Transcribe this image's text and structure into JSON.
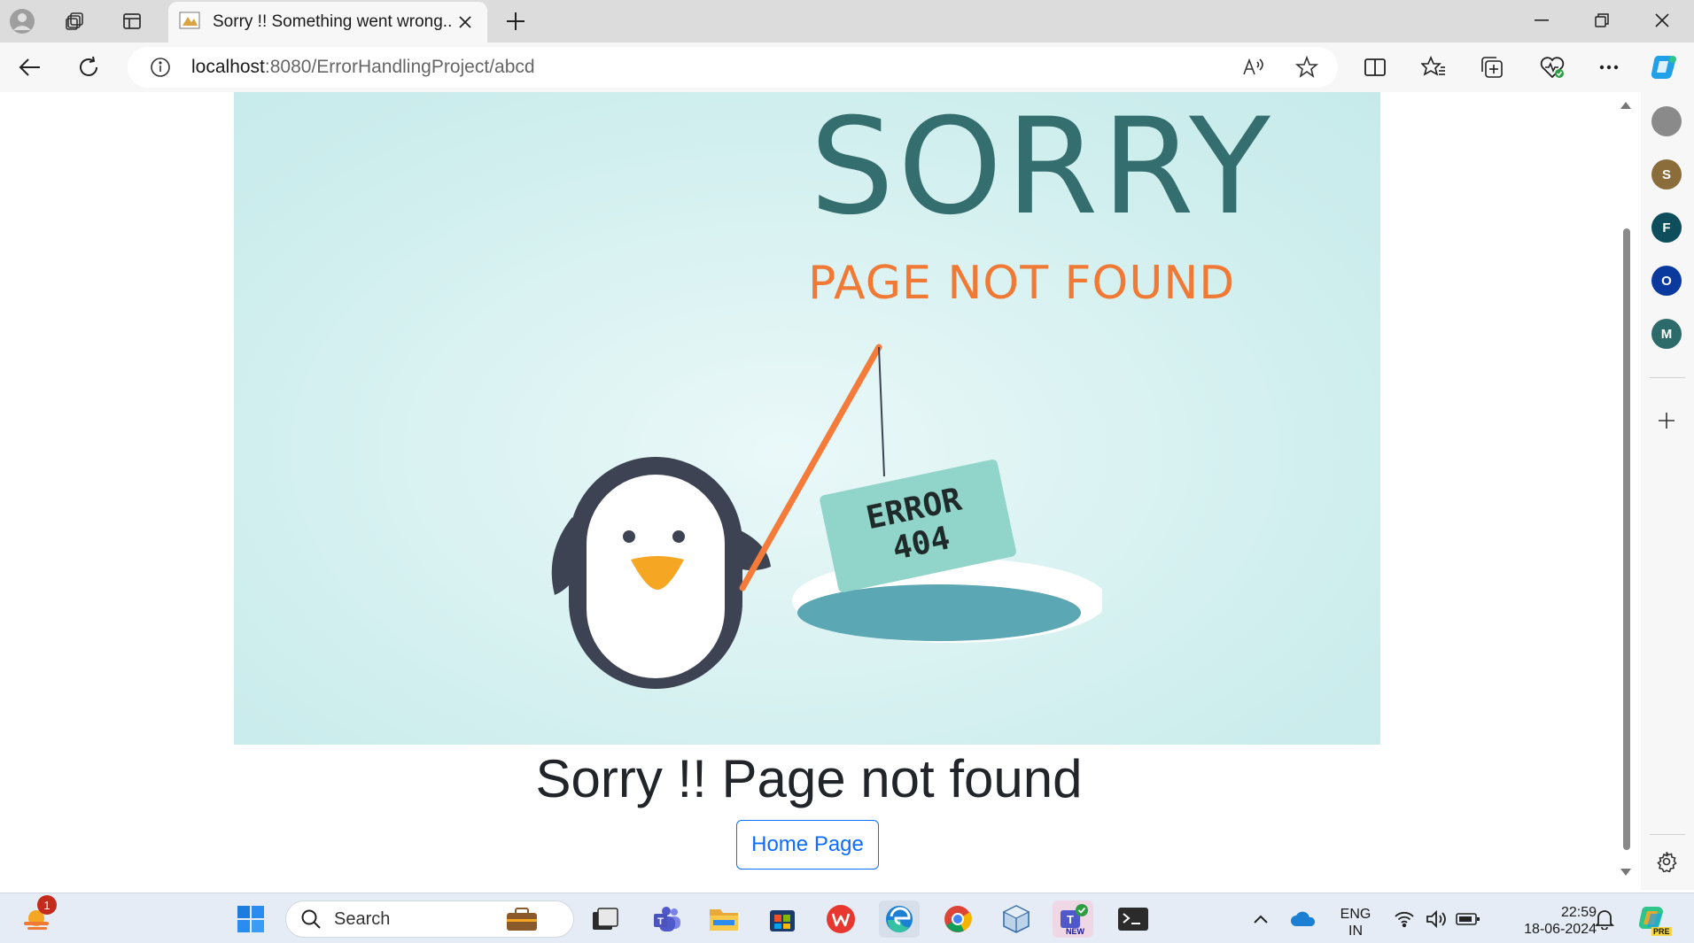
{
  "browser": {
    "tab_title": "Sorry !! Something went wrong...",
    "url_host": "localhost",
    "url_path": ":8080/ErrorHandlingProject/abcd",
    "sidebar_avatars": [
      {
        "letter": "S",
        "color": "#8a6d3b"
      },
      {
        "letter": "F",
        "color": "#0d4d5c"
      },
      {
        "letter": "O",
        "color": "#0a3a9e"
      },
      {
        "letter": "M",
        "color": "#2d6a6a"
      }
    ]
  },
  "page": {
    "hero_sorry": "SORRY",
    "hero_subtitle": "PAGE NOT FOUND",
    "sign_line1": "ERROR",
    "sign_line2": "404",
    "heading": "Sorry !! Page not found",
    "home_button": "Home Page"
  },
  "taskbar": {
    "search_placeholder": "Search",
    "notification_count": "1",
    "language_line1": "ENG",
    "language_line2": "IN",
    "time": "22:59",
    "date": "18-06-2024",
    "teams_badge": "NEW",
    "copilot_badge": "PRE"
  },
  "colors": {
    "accent": "#0d6efd",
    "hero_bg": "#cfeeee",
    "sorry_text": "#356e6e",
    "subtitle_text": "#f07a35"
  }
}
